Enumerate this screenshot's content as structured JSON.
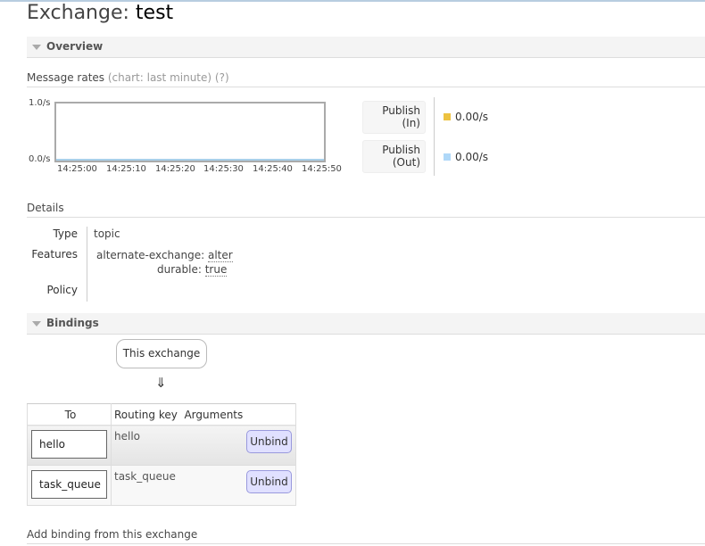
{
  "page": {
    "title_prefix": "Exchange:",
    "title_name": "test"
  },
  "overview": {
    "header": "Overview",
    "message_rates": {
      "label": "Message rates",
      "chart_range": "(chart: last minute)",
      "help": "(?)"
    },
    "chart": {
      "y_max_label": "1.0/s",
      "y_min_label": "0.0/s",
      "x_ticks": [
        "14:25:00",
        "14:25:10",
        "14:25:20",
        "14:25:30",
        "14:25:40",
        "14:25:50"
      ]
    },
    "legend": [
      {
        "label_line1": "Publish",
        "label_line2": "(In)",
        "value": "0.00/s",
        "color": "#edc240"
      },
      {
        "label_line1": "Publish",
        "label_line2": "(Out)",
        "value": "0.00/s",
        "color": "#afd8f8"
      }
    ]
  },
  "details": {
    "header": "Details",
    "type_label": "Type",
    "type_value": "topic",
    "features_label": "Features",
    "features": [
      {
        "key": "alternate-exchange:",
        "value": "alter"
      },
      {
        "key": "durable:",
        "value": "true"
      }
    ],
    "policy_label": "Policy",
    "policy_value": ""
  },
  "bindings": {
    "header": "Bindings",
    "this_exchange": "This exchange",
    "arrow": "⇓",
    "columns": {
      "to": "To",
      "routing_key": "Routing key",
      "arguments": "Arguments"
    },
    "rows": [
      {
        "to": "hello",
        "routing_key": "hello",
        "arguments": "",
        "action": "Unbind"
      },
      {
        "to": "task_queue",
        "routing_key": "task_queue",
        "arguments": "",
        "action": "Unbind"
      }
    ]
  },
  "add_binding": {
    "header": "Add binding from this exchange"
  }
}
